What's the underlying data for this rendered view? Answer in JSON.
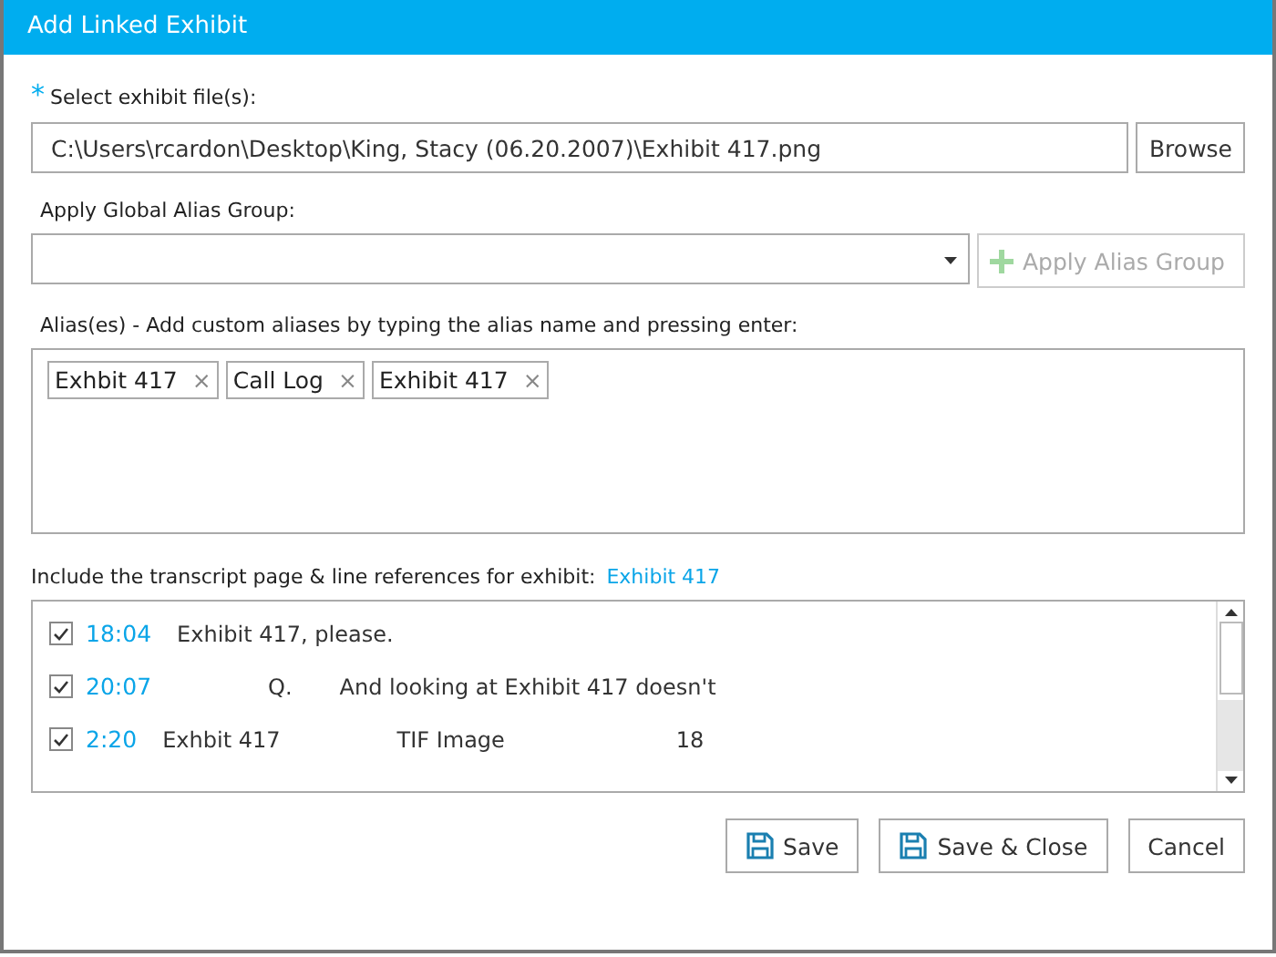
{
  "window": {
    "title": "Add Linked Exhibit"
  },
  "file": {
    "required_mark": "*",
    "label": "Select exhibit file(s):",
    "value": "C:\\Users\\rcardon\\Desktop\\King, Stacy (06.20.2007)\\Exhibit 417.png",
    "browse": "Browse"
  },
  "alias_group": {
    "label": "Apply Global Alias Group:",
    "apply": "Apply Alias Group",
    "apply_disabled": true
  },
  "aliases": {
    "label": "Alias(es) - Add custom aliases by typing the alias name and pressing enter:",
    "tags": [
      {
        "text": "Exhbit 417",
        "remove": "×"
      },
      {
        "text": "Call Log",
        "remove": "×"
      },
      {
        "text": "Exhibit 417",
        "remove": "×"
      }
    ]
  },
  "references": {
    "label": "Include the transcript page & line references for exhibit:",
    "exhibit": "Exhibit 417",
    "rows": [
      {
        "checked": true,
        "ref": "18:04",
        "parts": [
          "Exhibit 417, please."
        ]
      },
      {
        "checked": true,
        "ref": "20:07",
        "parts": [
          "Q.",
          "And looking at Exhibit 417 doesn't"
        ]
      },
      {
        "checked": true,
        "ref": "2:20",
        "parts": [
          "Exhbit 417",
          "TIF Image",
          "18"
        ]
      }
    ]
  },
  "buttons": [
    {
      "kind": "save",
      "label": "Save"
    },
    {
      "kind": "save",
      "label": "Save & Close"
    },
    {
      "kind": "plain",
      "label": "Cancel"
    }
  ]
}
